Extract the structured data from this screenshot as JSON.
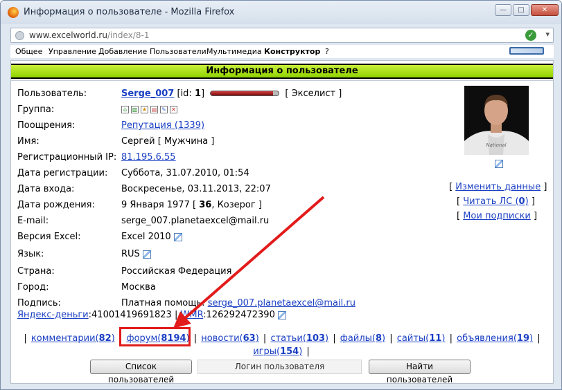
{
  "window": {
    "title": "Информация о пользователе - Mozilla Firefox",
    "min": "—",
    "max": "□",
    "close": "✕"
  },
  "url": {
    "host": "www.excelworld.ru",
    "path": "/index/8-1"
  },
  "menu": [
    "Общее",
    "Управление",
    "Добавление",
    "Пользователи",
    "Мультимедиа",
    "Конструктор",
    "?"
  ],
  "banner": "Информация о пользователе",
  "profile": {
    "user_label": "Пользователь:",
    "username": "Serge_007",
    "id_prefix": "[id:",
    "id": "1",
    "id_suffix": "]",
    "rank": "[ Экселист ]",
    "group_label": "Группа:",
    "awards_label": "Поощрения:",
    "reputation": "Репутация (1339)",
    "name_label": "Имя:",
    "name": "Сергей",
    "gender": "[ Мужчина ]",
    "ip_label": "Регистрационный IP:",
    "ip": "81.195.6.55",
    "reg_label": "Дата регистрации:",
    "reg_date": "Суббота, 31.07.2010, 01:54",
    "login_label": "Дата входа:",
    "login_date": "Воскресенье, 03.11.2013, 22:07",
    "birth_label": "Дата рождения:",
    "birth_date": "9 Января 1977",
    "age_open": "[",
    "age": "36",
    "age_rest": ", Козерог ]",
    "email_label": "E-mail:",
    "email": "serge_007.planetaexcel@mail.ru",
    "excel_label": "Версия Excel:",
    "excel": "Excel 2010",
    "lang_label": "Язык:",
    "lang": "RUS",
    "country_label": "Страна:",
    "country": "Российская Федерация",
    "city_label": "Город:",
    "city": "Москва",
    "signature_label": "Подпись:",
    "signature_text": "Платная помощь:",
    "signature_email": "serge_007.planetaexcel@mail.ru",
    "yandex_label": "Яндекс-деньги",
    "yandex": ":41001419691823",
    "wmr_sep": "|",
    "wmr_label": "WMR",
    "wmr": ":126292472390"
  },
  "side_links": [
    {
      "open": "[",
      "label": "Изменить данные",
      "close": "]"
    },
    {
      "open": "[",
      "label": "Читать ЛС (",
      "count": "0",
      "tail": ")",
      "close": "]"
    },
    {
      "open": "[",
      "label": "Мои подписки",
      "close": "]"
    }
  ],
  "stats": [
    {
      "label": "комментарии(",
      "count": "82"
    },
    {
      "label": "форум(",
      "count": "8194"
    },
    {
      "label": "новости(",
      "count": "63"
    },
    {
      "label": "статьи(",
      "count": "103"
    },
    {
      "label": "файлы(",
      "count": "8"
    },
    {
      "label": "сайты(",
      "count": "11"
    },
    {
      "label": "объявления(",
      "count": "19"
    },
    {
      "label": "игры(",
      "count": "154"
    }
  ],
  "bottom": {
    "list_button": "Список пользователей",
    "login_placeholder": "Логин пользователя",
    "find_button": "Найти пользователей"
  },
  "accent": {
    "banner": "#a6dd14",
    "link": "#1a3fc3",
    "highlight": "#e21b1b"
  }
}
